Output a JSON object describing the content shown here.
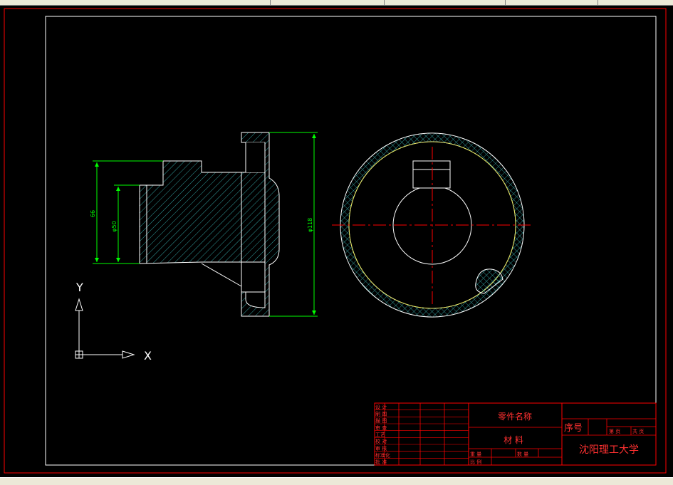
{
  "colors": {
    "background": "#000000",
    "border": "#ff0000",
    "outline": "#ffffff",
    "hatch": "#40c8c8",
    "dimension": "#00ff00",
    "centerline": "#ff0000",
    "title_text": "#ff3030"
  },
  "dimensions": {
    "left_outer": "66",
    "left_inner": "φ50",
    "right": "φ118"
  },
  "ucs": {
    "y_label": "Y",
    "x_label": "X",
    "icon": "ucs-axis-icon"
  },
  "title_block": {
    "part_name": "零件名称",
    "material": "材 料",
    "serial": "序号",
    "university": "沈阳理工大学",
    "row_labels": [
      "设 计",
      "制 图",
      "描 图",
      "审 查",
      "工艺",
      "校 对",
      "审 核",
      "标准化",
      "批 准"
    ],
    "scale_labels": [
      "重 量",
      "数 量",
      "比 例"
    ],
    "sheet_labels": [
      "第 页",
      "共 页"
    ]
  }
}
